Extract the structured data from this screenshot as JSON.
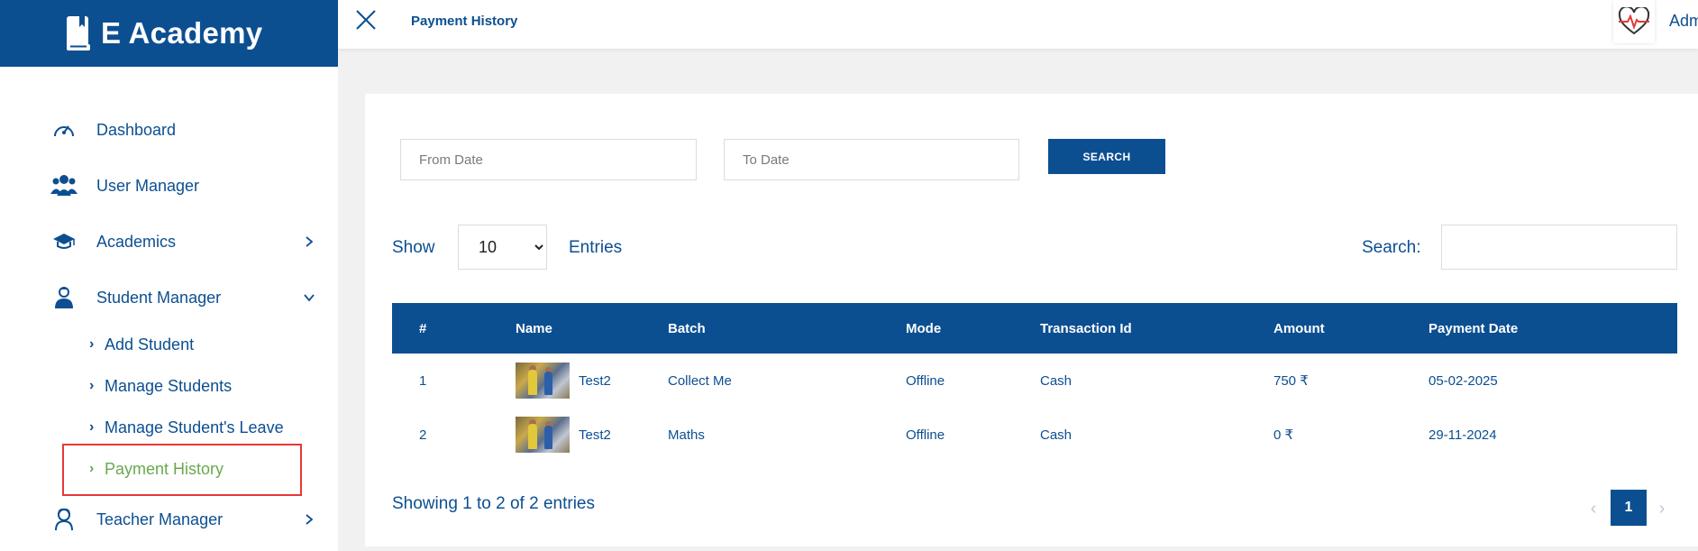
{
  "brand": {
    "title": "E Academy"
  },
  "colors": {
    "primary": "#0c4f91",
    "active": "#6aa84f",
    "highlight": "#e53935"
  },
  "sidebar": {
    "items": [
      {
        "label": "Dashboard",
        "icon": "speedometer-icon"
      },
      {
        "label": "User Manager",
        "icon": "users-icon"
      },
      {
        "label": "Academics",
        "icon": "graduation-cap-icon",
        "expandable": true,
        "expanded": false
      },
      {
        "label": "Student Manager",
        "icon": "student-icon",
        "expandable": true,
        "expanded": true
      },
      {
        "label": "Teacher Manager",
        "icon": "teacher-icon",
        "expandable": true,
        "expanded": false
      }
    ],
    "student_sub": [
      {
        "label": "Add Student"
      },
      {
        "label": "Manage Students"
      },
      {
        "label": "Manage Student's Leave"
      },
      {
        "label": "Payment History",
        "active": true
      }
    ]
  },
  "topbar": {
    "title": "Payment History",
    "user": "Adm"
  },
  "filters": {
    "from_placeholder": "From Date",
    "to_placeholder": "To Date",
    "search_button": "SEARCH"
  },
  "table_controls": {
    "show_label": "Show",
    "entries_value": "10",
    "entries_label": "Entries",
    "search_label": "Search:"
  },
  "table": {
    "headers": [
      "#",
      "Name",
      "Batch",
      "Mode",
      "Transaction Id",
      "Amount",
      "Payment Date"
    ],
    "rows": [
      {
        "num": "1",
        "name": "Test2",
        "batch": "Collect Me",
        "mode": "Offline",
        "txn": "Cash",
        "amount": "750 ₹",
        "date": "05-02-2025"
      },
      {
        "num": "2",
        "name": "Test2",
        "batch": "Maths",
        "mode": "Offline",
        "txn": "Cash",
        "amount": "0 ₹",
        "date": "29-11-2024"
      }
    ]
  },
  "footer": {
    "info": "Showing 1 to 2 of 2 entries",
    "current_page": "1",
    "prev": "‹",
    "next": "›"
  }
}
